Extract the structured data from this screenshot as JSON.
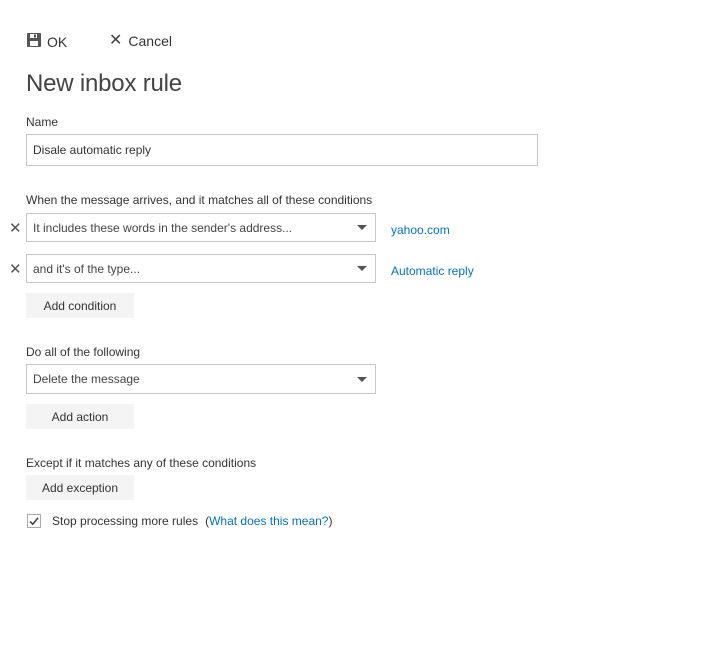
{
  "toolbar": {
    "ok_label": "OK",
    "ok_icon": "save-icon",
    "cancel_label": "Cancel",
    "cancel_icon": "close-icon"
  },
  "page_title": "New inbox rule",
  "name_field": {
    "label": "Name",
    "value": "Disale automatic reply"
  },
  "conditions": {
    "heading": "When the message arrives, and it matches all of these conditions",
    "items": [
      {
        "selected": "It includes these words in the sender's address...",
        "value_link": "yahoo.com"
      },
      {
        "selected": "and it's of the type...",
        "value_link": "Automatic reply"
      }
    ],
    "add_label": "Add condition"
  },
  "actions": {
    "heading": "Do all of the following",
    "selected": "Delete the message",
    "add_label": "Add action"
  },
  "exceptions": {
    "heading": "Except if it matches any of these conditions",
    "add_label": "Add exception"
  },
  "stop_processing": {
    "checked": true,
    "label": "Stop processing more rules",
    "help_open": "(",
    "help_link": "What does this mean?",
    "help_close": ")"
  },
  "colors": {
    "link": "#0072c6",
    "button_bg": "#f4f4f4",
    "border": "#c8c8c8"
  }
}
